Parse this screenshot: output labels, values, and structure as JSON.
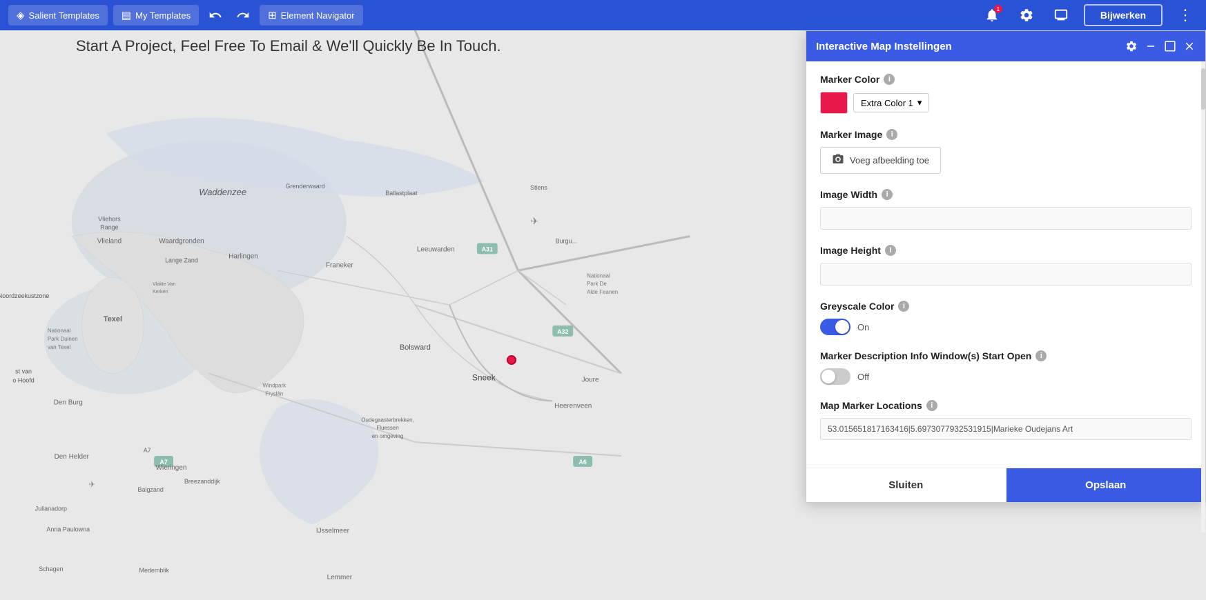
{
  "toolbar": {
    "salient_templates_label": "Salient Templates",
    "my_templates_label": "My Templates",
    "element_navigator_label": "Element Navigator",
    "bijwerken_label": "Bijwerken"
  },
  "page": {
    "subtitle": "Start A Project, Feel Free To Email & We'll Quickly Be In Touch."
  },
  "panel": {
    "title": "Interactive Map Instellingen",
    "sections": {
      "marker_color": {
        "label": "Marker Color",
        "color_value": "#e8194a",
        "dropdown_label": "Extra Color 1"
      },
      "marker_image": {
        "label": "Marker Image",
        "add_button_label": "Voeg afbeelding toe"
      },
      "image_width": {
        "label": "Image Width",
        "placeholder": ""
      },
      "image_height": {
        "label": "Image Height",
        "placeholder": ""
      },
      "greyscale_color": {
        "label": "Greyscale Color",
        "toggle_on": true,
        "toggle_label": "On"
      },
      "marker_description": {
        "label": "Marker Description Info Window(s) Start Open",
        "toggle_on": false,
        "toggle_label": "Off"
      },
      "map_marker_locations": {
        "label": "Map Marker Locations",
        "value": "53.015651817163416|5.6973077932531915|Marieke Oudejans Art"
      }
    },
    "footer": {
      "sluiten_label": "Sluiten",
      "opslaan_label": "Opslaan"
    }
  }
}
